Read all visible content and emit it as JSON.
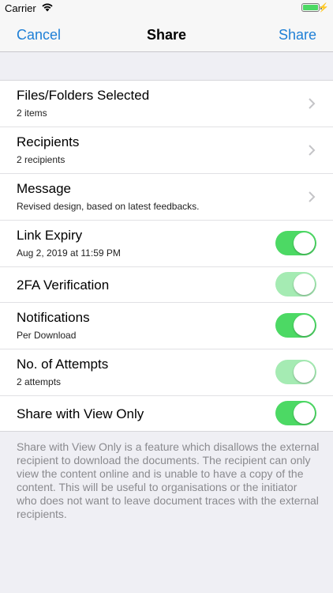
{
  "status_bar": {
    "carrier": "Carrier",
    "wifi_icon": "wifi-icon",
    "battery_icon": "battery-icon",
    "charging_icon": "bolt-icon"
  },
  "nav": {
    "cancel_label": "Cancel",
    "title": "Share",
    "share_label": "Share"
  },
  "rows": [
    {
      "title": "Files/Folders Selected",
      "subtitle": "2 items",
      "accessory": "chevron"
    },
    {
      "title": "Recipients",
      "subtitle": "2 recipients",
      "accessory": "chevron"
    },
    {
      "title": "Message",
      "subtitle": "Revised design, based on latest feedbacks.",
      "accessory": "chevron"
    },
    {
      "title": "Link Expiry",
      "subtitle": "Aug 2, 2019 at 11:59 PM",
      "accessory": "toggle",
      "on": true,
      "enabled": true
    },
    {
      "title": "2FA Verification",
      "subtitle": "",
      "accessory": "toggle",
      "on": true,
      "enabled": false
    },
    {
      "title": "Notifications",
      "subtitle": "Per Download",
      "accessory": "toggle",
      "on": true,
      "enabled": true
    },
    {
      "title": "No. of Attempts",
      "subtitle": "2 attempts",
      "accessory": "toggle",
      "on": true,
      "enabled": false
    },
    {
      "title": "Share with View Only",
      "subtitle": "",
      "accessory": "toggle",
      "on": true,
      "enabled": true
    }
  ],
  "footer_text": "Share with View Only is a feature which disallows the external recipient to download the documents. The recipient can only view the content online and is unable to have a copy of the content. This will be useful to organisations or the initiator who does not want to leave document traces with the external recipients.",
  "colors": {
    "accent": "#1e7fd6",
    "toggle_on": "#4cd964",
    "toggle_disabled": "#a5ebb3",
    "background": "#efeff4"
  }
}
